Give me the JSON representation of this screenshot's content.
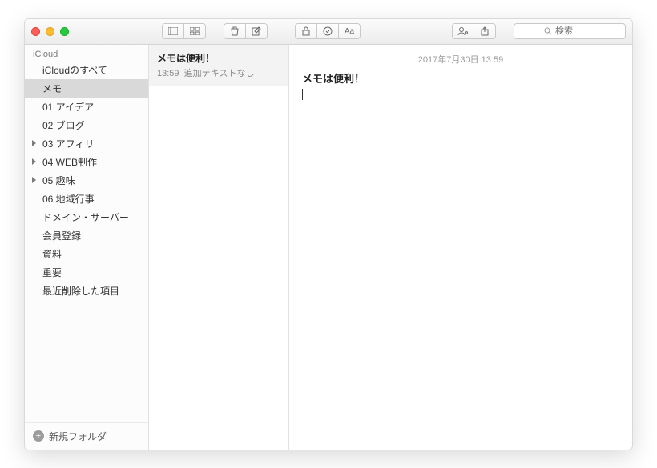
{
  "toolbar": {
    "search_placeholder": "検索"
  },
  "sidebar": {
    "section": "iCloud",
    "items": [
      {
        "label": "iCloudのすべて",
        "expandable": false,
        "selected": false
      },
      {
        "label": "メモ",
        "expandable": false,
        "selected": true
      },
      {
        "label": "01 アイデア",
        "expandable": false,
        "selected": false
      },
      {
        "label": "02 ブログ",
        "expandable": false,
        "selected": false
      },
      {
        "label": "03 アフィリ",
        "expandable": true,
        "selected": false
      },
      {
        "label": "04 WEB制作",
        "expandable": true,
        "selected": false
      },
      {
        "label": "05 趣味",
        "expandable": true,
        "selected": false
      },
      {
        "label": "06 地域行事",
        "expandable": false,
        "selected": false
      },
      {
        "label": "ドメイン・サーバー",
        "expandable": false,
        "selected": false
      },
      {
        "label": "会員登録",
        "expandable": false,
        "selected": false
      },
      {
        "label": "資料",
        "expandable": false,
        "selected": false
      },
      {
        "label": "重要",
        "expandable": false,
        "selected": false
      },
      {
        "label": "最近削除した項目",
        "expandable": false,
        "selected": false
      }
    ],
    "new_folder_label": "新規フォルダ"
  },
  "notelist": {
    "items": [
      {
        "title": "メモは便利！",
        "time": "13:59",
        "snippet": "追加テキストなし"
      }
    ]
  },
  "editor": {
    "datestamp": "2017年7月30日 13:59",
    "title": "メモは便利！"
  }
}
